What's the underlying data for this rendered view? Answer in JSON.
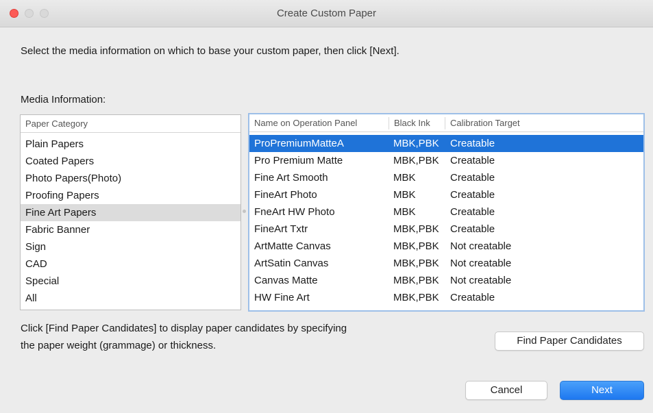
{
  "window": {
    "title": "Create Custom Paper"
  },
  "instruction": "Select the media information on which to base your custom paper, then click [Next].",
  "media_label": "Media Information:",
  "category_panel": {
    "header": "Paper Category",
    "items": [
      "Plain Papers",
      "Coated Papers",
      "Photo Papers(Photo)",
      "Proofing Papers",
      "Fine Art Papers",
      "Fabric Banner",
      "Sign",
      "CAD",
      "Special",
      "All"
    ],
    "selected": "Fine Art Papers"
  },
  "media_table": {
    "headers": {
      "name": "Name on Operation Panel",
      "ink": "Black Ink",
      "calibration": "Calibration Target"
    },
    "rows": [
      {
        "name": "ProPremiumMatteA",
        "ink": "MBK,PBK",
        "calibration": "Creatable"
      },
      {
        "name": "Pro Premium Matte",
        "ink": "MBK,PBK",
        "calibration": "Creatable"
      },
      {
        "name": "Fine Art Smooth",
        "ink": "MBK",
        "calibration": "Creatable"
      },
      {
        "name": "FineArt Photo",
        "ink": "MBK",
        "calibration": "Creatable"
      },
      {
        "name": "FneArt HW Photo",
        "ink": "MBK",
        "calibration": "Creatable"
      },
      {
        "name": "FineArt Txtr",
        "ink": "MBK,PBK",
        "calibration": "Creatable"
      },
      {
        "name": "ArtMatte Canvas",
        "ink": "MBK,PBK",
        "calibration": "Not creatable"
      },
      {
        "name": "ArtSatin Canvas",
        "ink": "MBK,PBK",
        "calibration": "Not creatable"
      },
      {
        "name": "Canvas Matte",
        "ink": "MBK,PBK",
        "calibration": "Not creatable"
      },
      {
        "name": "HW Fine Art",
        "ink": "MBK,PBK",
        "calibration": "Creatable"
      }
    ],
    "selected_index": 0
  },
  "hint": {
    "line1": "Click [Find Paper Candidates] to display paper candidates by specifying",
    "line2": "the paper weight (grammage) or thickness."
  },
  "buttons": {
    "find": "Find Paper Candidates",
    "cancel": "Cancel",
    "next": "Next"
  },
  "colors": {
    "selection": "#1f73d8",
    "accent": "#2a8bf5",
    "close": "#fc5b57"
  }
}
